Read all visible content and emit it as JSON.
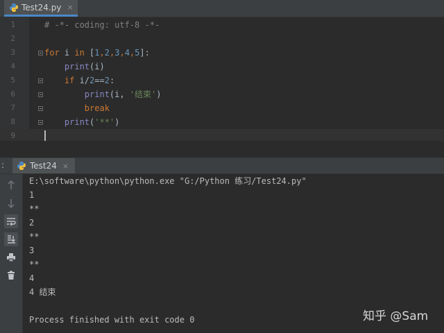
{
  "editor_tab": {
    "label": "Test24.py",
    "close": "×"
  },
  "code_lines": [
    {
      "num": "1",
      "parts": [
        {
          "t": "# -*- coding: utf-8 -*-",
          "c": "com"
        }
      ]
    },
    {
      "num": "2",
      "parts": []
    },
    {
      "num": "3",
      "parts": [
        {
          "t": "for",
          "c": "kw"
        },
        {
          "t": " i ",
          "c": ""
        },
        {
          "t": "in",
          "c": "kw"
        },
        {
          "t": " [",
          "c": ""
        },
        {
          "t": "1",
          "c": "num"
        },
        {
          "t": ",",
          "c": "kw"
        },
        {
          "t": "2",
          "c": "num"
        },
        {
          "t": ",",
          "c": "kw"
        },
        {
          "t": "3",
          "c": "num"
        },
        {
          "t": ",",
          "c": "kw"
        },
        {
          "t": "4",
          "c": "num"
        },
        {
          "t": ",",
          "c": "kw"
        },
        {
          "t": "5",
          "c": "num"
        },
        {
          "t": "]:",
          "c": ""
        }
      ]
    },
    {
      "num": "4",
      "parts": [
        {
          "t": "    ",
          "c": ""
        },
        {
          "t": "print",
          "c": "bi"
        },
        {
          "t": "(i)",
          "c": ""
        }
      ]
    },
    {
      "num": "5",
      "parts": [
        {
          "t": "    ",
          "c": ""
        },
        {
          "t": "if",
          "c": "kw"
        },
        {
          "t": " i/",
          "c": ""
        },
        {
          "t": "2",
          "c": "num"
        },
        {
          "t": "==",
          "c": ""
        },
        {
          "t": "2",
          "c": "num"
        },
        {
          "t": ":",
          "c": ""
        }
      ]
    },
    {
      "num": "6",
      "parts": [
        {
          "t": "        ",
          "c": ""
        },
        {
          "t": "print",
          "c": "bi"
        },
        {
          "t": "(i, ",
          "c": ""
        },
        {
          "t": "'结束'",
          "c": "str"
        },
        {
          "t": ")",
          "c": ""
        }
      ]
    },
    {
      "num": "7",
      "parts": [
        {
          "t": "        ",
          "c": ""
        },
        {
          "t": "break",
          "c": "kw"
        }
      ]
    },
    {
      "num": "8",
      "parts": [
        {
          "t": "    ",
          "c": ""
        },
        {
          "t": "print",
          "c": "bi"
        },
        {
          "t": "(",
          "c": ""
        },
        {
          "t": "'**'",
          "c": "str"
        },
        {
          "t": ")",
          "c": ""
        }
      ]
    },
    {
      "num": "9",
      "parts": []
    }
  ],
  "run_panel": {
    "prefix": ":",
    "tab_label": "Test24",
    "close": "×"
  },
  "console_lines": [
    "E:\\software\\python\\python.exe \"G:/Python 练习/Test24.py\"",
    "1",
    "**",
    "2",
    "**",
    "3",
    "**",
    "4",
    "4 结束",
    "",
    "Process finished with exit code 0"
  ],
  "toolbar_icons": [
    "arrow-up-icon",
    "arrow-down-icon",
    "soft-wrap-icon",
    "scroll-to-end-icon",
    "print-icon",
    "trash-icon"
  ],
  "watermark": "知乎 @Sam",
  "colors": {
    "keyword": "#cc7832",
    "number": "#6897bb",
    "string": "#6a8759",
    "comment": "#808080",
    "builtin": "#8888c6",
    "text": "#a9b7c6"
  }
}
